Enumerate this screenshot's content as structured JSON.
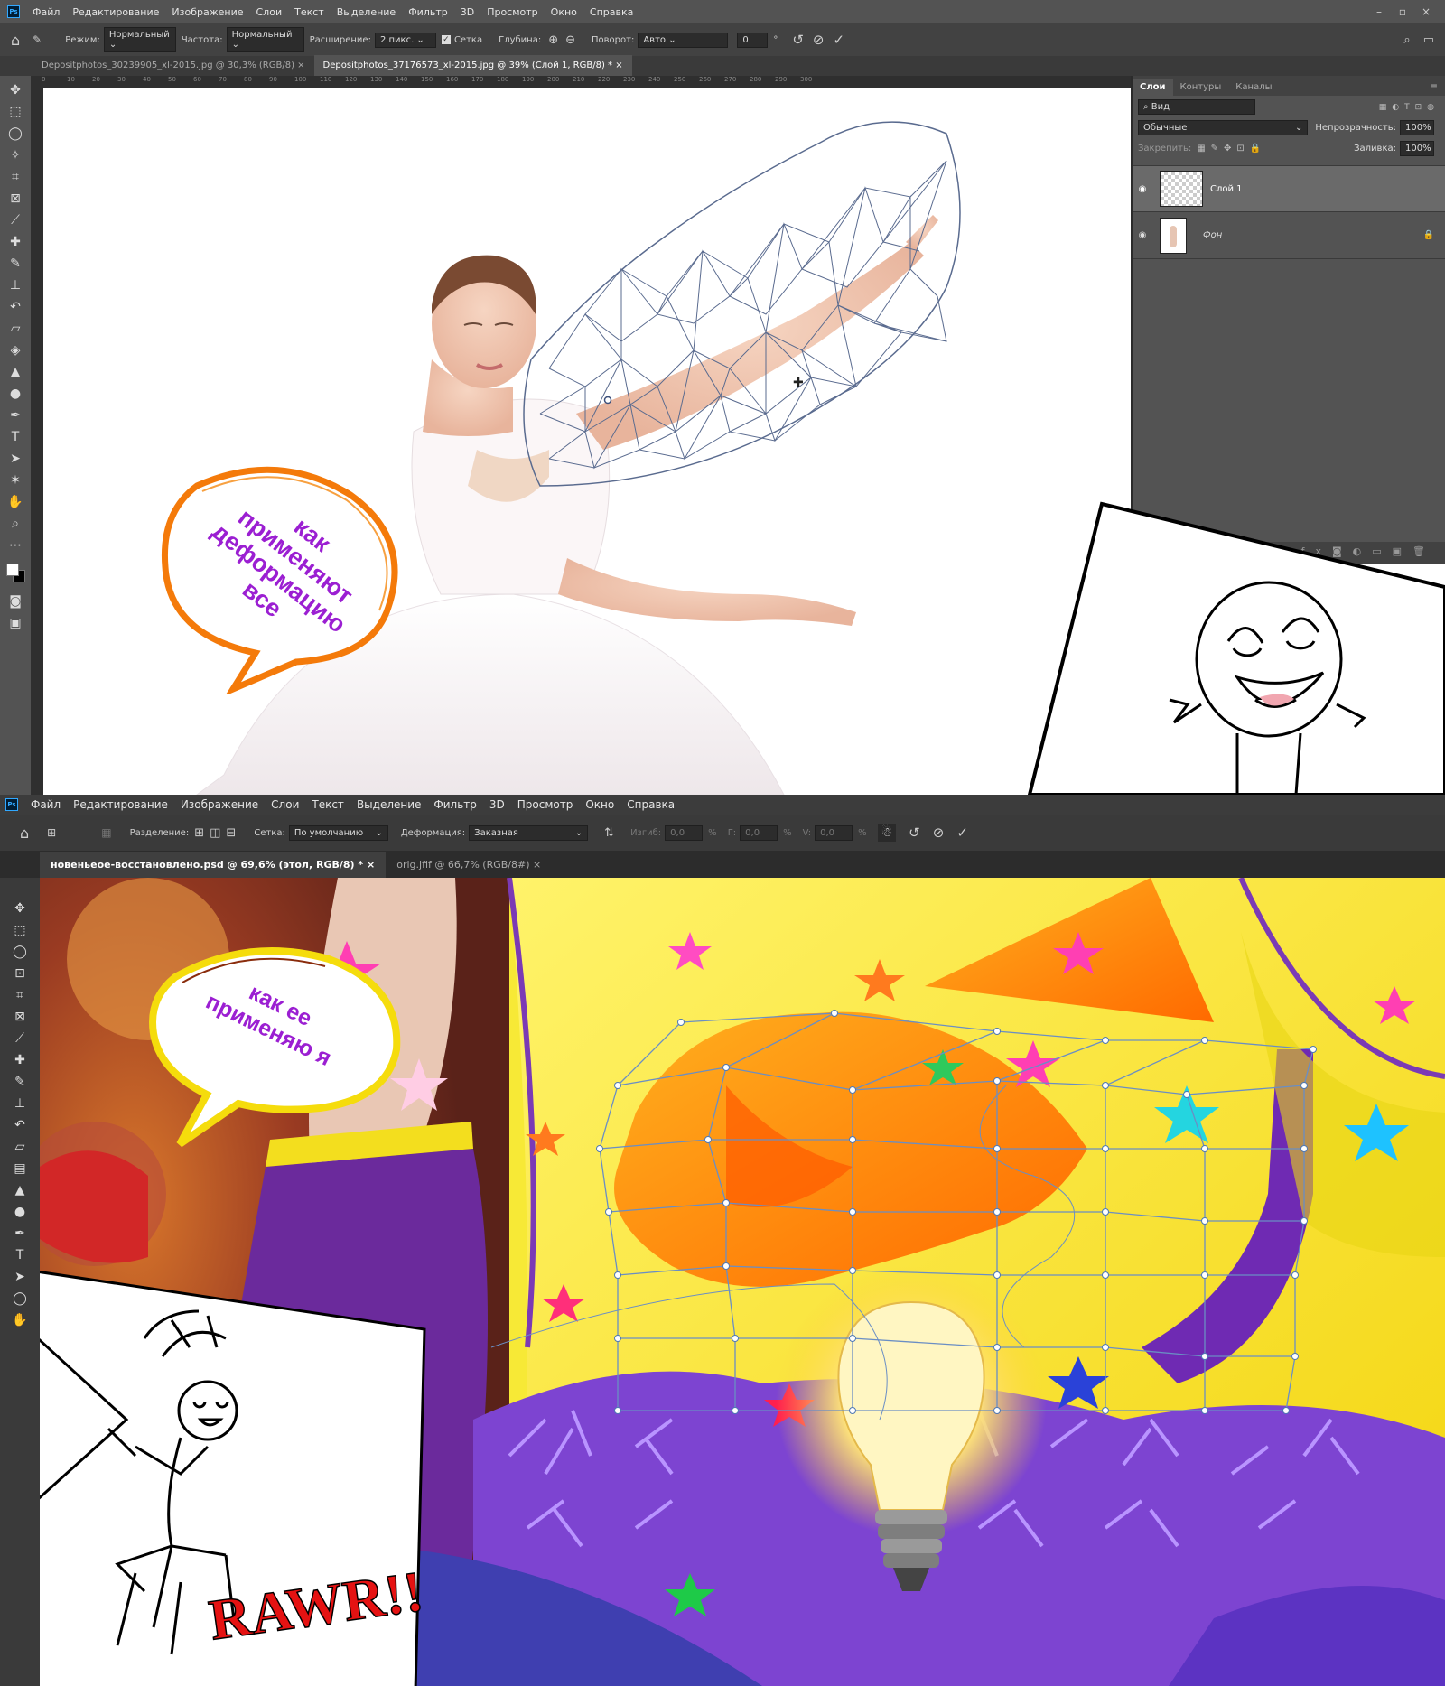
{
  "top": {
    "app_logo": "Ps",
    "menu": [
      "Файл",
      "Редактирование",
      "Изображение",
      "Слои",
      "Текст",
      "Выделение",
      "Фильтр",
      "3D",
      "Просмотр",
      "Окно",
      "Справка"
    ],
    "options": {
      "mode_label": "Режим:",
      "mode_value": "Нормальный",
      "density_label": "Частота:",
      "density_value": "Нормальный",
      "expand_label": "Расширение:",
      "expand_value": "2 пикс.",
      "mesh_label": "Сетка",
      "depth_label": "Глубина:",
      "rotate_label": "Поворот:",
      "rotate_value": "Авто",
      "angle_value": "0",
      "degree": "°"
    },
    "tabs": [
      {
        "label": "Depositphotos_30239905_xl-2015.jpg @ 30,3% (RGB/8)",
        "active": false
      },
      {
        "label": "Depositphotos_37176573_xl-2015.jpg @ 39% (Слой 1, RGB/8) *",
        "active": true
      }
    ],
    "ruler_ticks": [
      "0",
      "10",
      "20",
      "30",
      "40",
      "50",
      "60",
      "70",
      "80",
      "90",
      "100",
      "110",
      "120",
      "130",
      "140",
      "150",
      "160",
      "170",
      "180",
      "190",
      "200",
      "210",
      "220",
      "230",
      "240",
      "250",
      "260",
      "270",
      "280",
      "290",
      "300"
    ],
    "layers_panel": {
      "tabs": [
        "Слои",
        "Контуры",
        "Каналы"
      ],
      "search_placeholder": "Вид",
      "blend_mode": "Обычные",
      "opacity_label": "Непрозрачность:",
      "opacity_value": "100%",
      "lock_label": "Закрепить:",
      "fill_label": "Заливка:",
      "fill_value": "100%",
      "layers": [
        {
          "name": "Слой 1",
          "selected": true,
          "locked": false
        },
        {
          "name": "Фон",
          "selected": false,
          "locked": true
        }
      ]
    },
    "bubble_text": [
      "как",
      "применяют",
      "деформацию",
      "все"
    ]
  },
  "bottom": {
    "app_logo": "Ps",
    "menu": [
      "Файл",
      "Редактирование",
      "Изображение",
      "Слои",
      "Текст",
      "Выделение",
      "Фильтр",
      "3D",
      "Просмотр",
      "Окно",
      "Справка"
    ],
    "options": {
      "split_label": "Разделение:",
      "grid_label": "Сетка:",
      "grid_value": "По умолчанию",
      "warp_label": "Деформация:",
      "warp_value": "Заказная",
      "bend_label": "Изгиб:",
      "bend_value": "0,0",
      "bend_unit": "%",
      "h_label": "Г:",
      "h_value": "0,0",
      "h_unit": "%",
      "v_label": "V:",
      "v_value": "0,0",
      "v_unit": "%"
    },
    "tabs": [
      {
        "label": "новеньеое-восстановлено.psd @ 69,6% (этол, RGB/8) *",
        "active": true
      },
      {
        "label": "orig.jfif @ 66,7% (RGB/8#)",
        "active": false
      }
    ],
    "bubble_text": [
      "как ее",
      "применяю я"
    ],
    "rawr": "RAWR!!"
  }
}
